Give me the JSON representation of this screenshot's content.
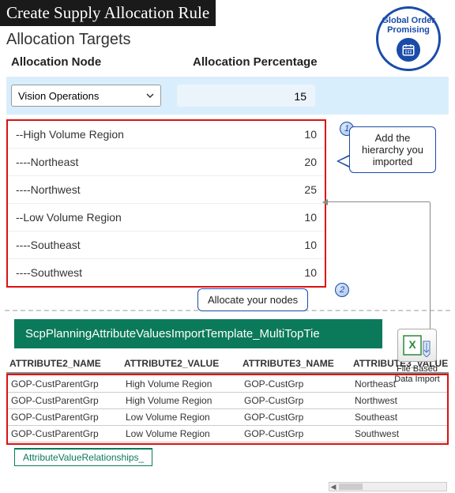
{
  "title": "Create Supply Allocation Rule",
  "subtitle": "Allocation Targets",
  "badge": {
    "line1": "Global Order",
    "line2": "Promising"
  },
  "columns": {
    "node": "Allocation Node",
    "pct": "Allocation Percentage"
  },
  "selected": {
    "label": "Vision Operations",
    "value": "15"
  },
  "hierarchy": [
    {
      "name": "--High Volume Region",
      "value": "10"
    },
    {
      "name": "----Northeast",
      "value": "20"
    },
    {
      "name": "----Northwest",
      "value": "25"
    },
    {
      "name": "--Low Volume Region",
      "value": "10"
    },
    {
      "name": "----Southeast",
      "value": "10"
    },
    {
      "name": "----Southwest",
      "value": "10"
    }
  ],
  "callouts": {
    "c1": "Add the hierarchy you imported",
    "c2": "Allocate your nodes",
    "m1": "1",
    "m2": "2"
  },
  "green_band": "ScpPlanningAttributeValuesImportTemplate_MultiTopTie",
  "file_import": {
    "l1": "File Based",
    "l2": "Data Import"
  },
  "table": {
    "headers": [
      "ATTRIBUTE2_NAME",
      "ATTRIBUTE2_VALUE",
      "ATTRIBUTE3_NAME",
      "ATTRIBUTE3_VALUE"
    ],
    "rows": [
      [
        "GOP-CustParentGrp",
        "High Volume Region",
        "GOP-CustGrp",
        "Northeast"
      ],
      [
        "GOP-CustParentGrp",
        "High Volume Region",
        "GOP-CustGrp",
        "Northwest"
      ],
      [
        "GOP-CustParentGrp",
        "Low Volume Region",
        "GOP-CustGrp",
        "Southeast"
      ],
      [
        "GOP-CustParentGrp",
        "Low Volume Region",
        "GOP-CustGrp",
        "Southwest"
      ]
    ]
  },
  "sheet_tab": "AttributeValueRelationships_"
}
